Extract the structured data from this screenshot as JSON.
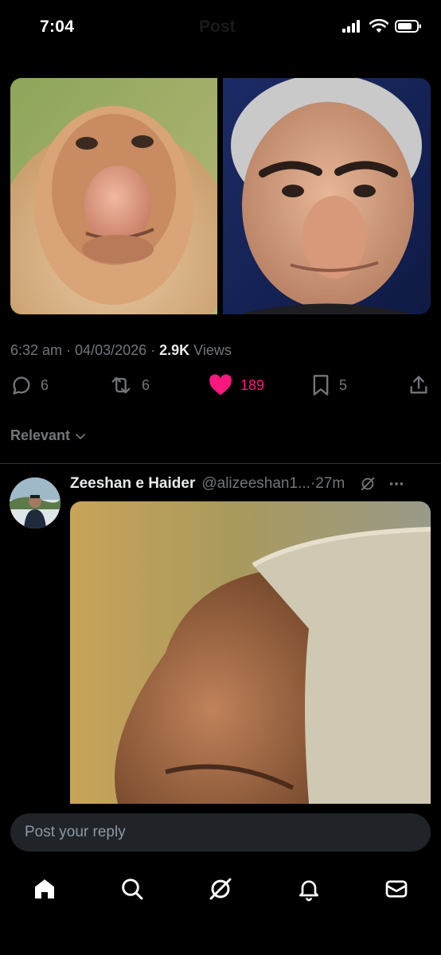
{
  "status_bar": {
    "time": "7:04",
    "title": "Post"
  },
  "post": {
    "left_image": "proboscis-monkey-face",
    "right_image": "man-with-large-nose-face",
    "meta": {
      "time": "6:32 am",
      "sep1": " · ",
      "date": "04/03/2026",
      "sep2": " · ",
      "views": "2.9K",
      "views_label": " Views"
    },
    "actions": {
      "replies": "6",
      "reposts": "6",
      "likes": "189",
      "bookmarks": "5"
    },
    "colors": {
      "like": "#f91880",
      "muted": "#71767b"
    }
  },
  "sort": {
    "label": "Relevant"
  },
  "reply": {
    "name": "Zeeshan e Haider",
    "handle": "@alizeeshan1...",
    "sep": " · ",
    "age": "27m",
    "image": "close-up-large-nose"
  },
  "composer": {
    "placeholder": "Post your reply"
  },
  "nav": [
    "home-icon",
    "search-icon",
    "grok-icon",
    "notifications-icon",
    "messages-icon"
  ]
}
